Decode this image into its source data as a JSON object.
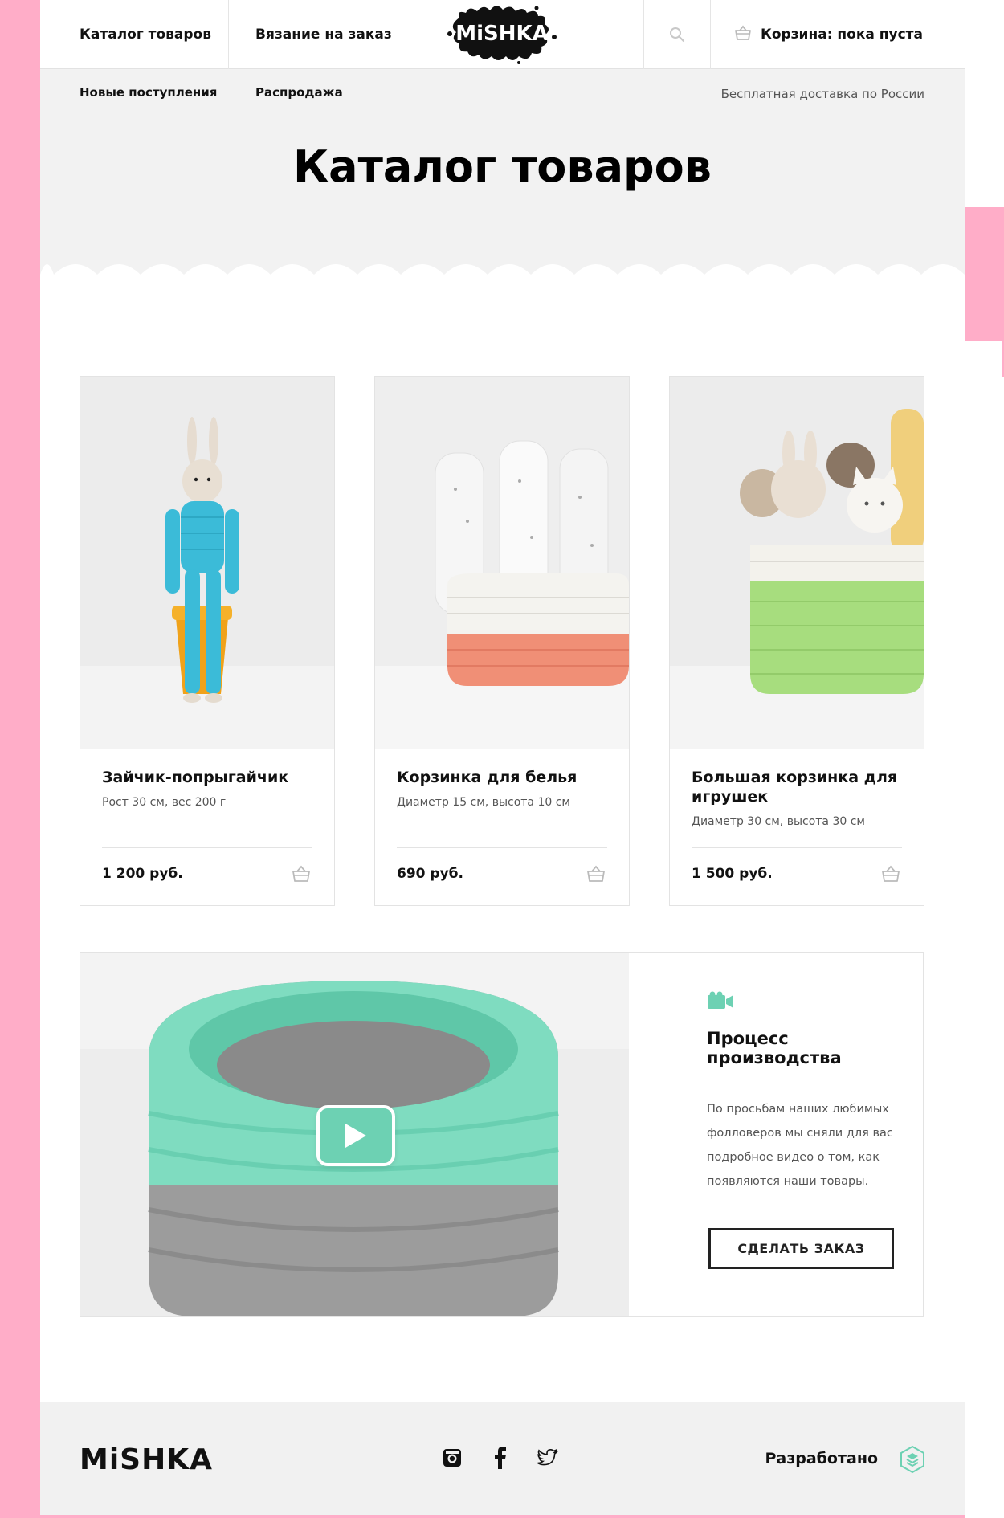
{
  "header": {
    "nav": [
      "Каталог товаров",
      "Вязание на заказ"
    ],
    "logo_text": "MiSHKA",
    "cart_text": "Корзина: пока пуста"
  },
  "subnav": {
    "items": [
      "Новые поступления",
      "Распродажа"
    ],
    "delivery": "Бесплатная доставка по России"
  },
  "page_title": "Каталог товаров",
  "products": [
    {
      "title": "Зайчик-попрыгайчик",
      "desc": "Рост 30 см, вес 200 г",
      "price": "1 200 руб."
    },
    {
      "title": "Корзинка для белья",
      "desc": "Диаметр 15 см, высота 10 см",
      "price": "690 руб."
    },
    {
      "title": "Большая корзинка для игрушек",
      "desc": "Диаметр 30 см, высота 30 см",
      "price": "1 500 руб."
    }
  ],
  "video": {
    "title": "Процесс производства",
    "text": "По просьбам наших любимых фолловеров мы сняли для вас подробное видео о том, как появляются наши товары.",
    "button": "СДЕЛАТЬ ЗАКАЗ"
  },
  "footer": {
    "logo_text": "MiSHKA",
    "social": [
      "instagram-icon",
      "facebook-icon",
      "twitter-icon"
    ],
    "developed_label": "Разработано"
  },
  "colors": {
    "pink": "#ffadc8",
    "mint": "#6dd1b3",
    "hero_bg": "#f2f2f2"
  }
}
